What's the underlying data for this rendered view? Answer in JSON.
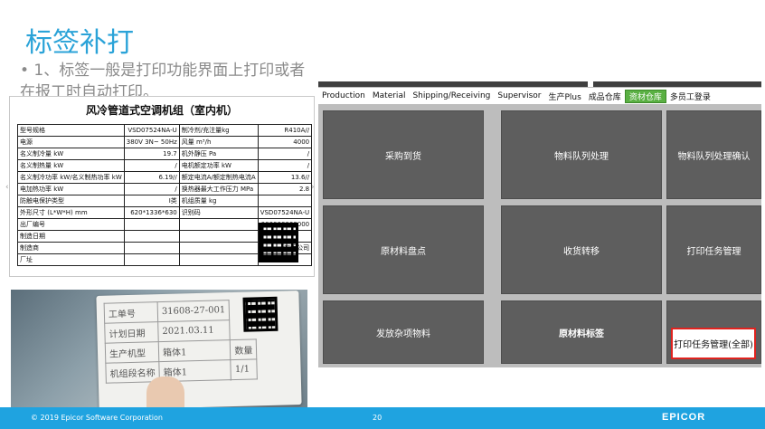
{
  "slide": {
    "title": "标签补打",
    "bullet": "• 1、标签一般是打印功能界面上打印或者在报工时自动打印。"
  },
  "label": {
    "title": "风冷管道式空调机组（室内机）",
    "rows": [
      [
        "型号规格",
        "VSD07524NA-U",
        "制冷剂/充注量kg",
        "R410A//"
      ],
      [
        "电源",
        "380V 3N~ 50Hz",
        "风量 m³/h",
        "4000"
      ],
      [
        "名义制冷量 kW",
        "19.7",
        "机外静压 Pa",
        "/"
      ],
      [
        "名义制热量 kW",
        "/",
        "电机额定功率 kW",
        "/"
      ],
      [
        "名义制冷功率 kW/名义制热功率 kW",
        "6.19//",
        "额定电流A/额定制热电流A",
        "13.6//"
      ],
      [
        "电加热功率 kW",
        "/",
        "换热器最大工作压力 MPa",
        "2.8"
      ],
      [
        "防触电保护类型",
        "I类",
        "机组质量 kg",
        ""
      ],
      [
        "外形尺寸 (L*W*H) mm",
        "620*1336*630",
        "识别码",
        "VSD07524NA-U"
      ],
      [
        "出厂编号",
        "",
        "",
        "000000000000"
      ],
      [
        "制造日期",
        "",
        "",
        ""
      ],
      [
        "制造商",
        "",
        "",
        "有限公司"
      ],
      [
        "厂址",
        "",
        "",
        ""
      ]
    ]
  },
  "photo_label": {
    "rows": [
      [
        "工单号",
        "31608-27-001"
      ],
      [
        "计划日期",
        "2021.03.11"
      ],
      [
        "生产机型",
        "箱体1"
      ],
      [
        "机组段名称",
        "箱体1"
      ]
    ],
    "qty_label": "数量",
    "qty_value": "1/1"
  },
  "nav": {
    "items": [
      "Production",
      "Material",
      "Shipping/Receiving",
      "Supervisor",
      "生产Plus",
      "成品仓库",
      "资材仓库",
      "多员工登录"
    ],
    "active_index": 6
  },
  "buttons": {
    "purchase_receipt": "采购到货",
    "material_queue": "物料队列处理",
    "material_queue_confirm": "物料队列处理确认",
    "raw_inventory": "原材料盘点",
    "transfer": "收货转移",
    "print_task": "打印任务管理",
    "misc_issue": "发放杂项物料",
    "raw_label": "原材料标签",
    "print_task_all": "打印任务管理(全部)"
  },
  "footer": {
    "copyright": "© 2019 Epicor Software Corporation",
    "page": "20",
    "logo": "EPICOR"
  },
  "colors": {
    "title": "#2ba3d8",
    "footer": "#1fa3e0",
    "tile": "#5e5e5e",
    "active_tab": "#5ab043",
    "highlight": "#e0231f"
  }
}
